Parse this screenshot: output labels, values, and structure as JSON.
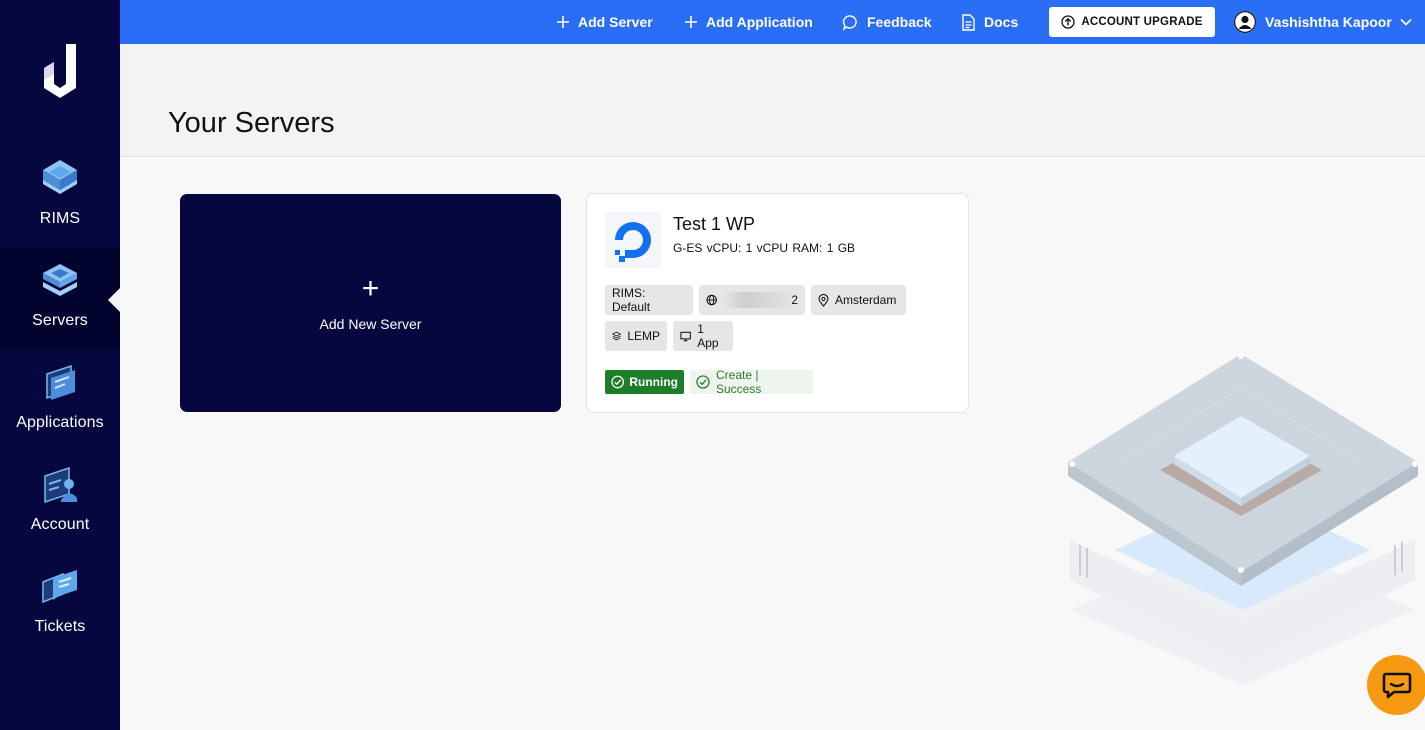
{
  "sidebar": {
    "items": [
      {
        "label": "RIMS",
        "icon": "rims-icon",
        "active": false
      },
      {
        "label": "Servers",
        "icon": "servers-icon",
        "active": true
      },
      {
        "label": "Applications",
        "icon": "applications-icon",
        "active": false
      },
      {
        "label": "Account",
        "icon": "account-icon",
        "active": false
      },
      {
        "label": "Tickets",
        "icon": "tickets-icon",
        "active": false
      }
    ]
  },
  "topbar": {
    "add_server": "Add Server",
    "add_application": "Add Application",
    "feedback": "Feedback",
    "docs": "Docs",
    "upgrade": "ACCOUNT UPGRADE",
    "user_name": "Vashishtha Kapoor"
  },
  "page": {
    "title": "Your Servers",
    "add_new_server": "Add New Server"
  },
  "server": {
    "name": "Test 1 WP",
    "specs": "G-ES  vCPU: 1 vCPU  RAM: 1 GB",
    "rims": "RIMS: Default",
    "ip_suffix": "2",
    "location": "Amsterdam",
    "stack": "LEMP",
    "apps": "1 App",
    "status": "Running",
    "operation": "Create | Success"
  },
  "colors": {
    "sidebar": "#06073f",
    "topbar": "#2b6ef6",
    "running": "#1e7d28",
    "chat": "#f79a12"
  }
}
